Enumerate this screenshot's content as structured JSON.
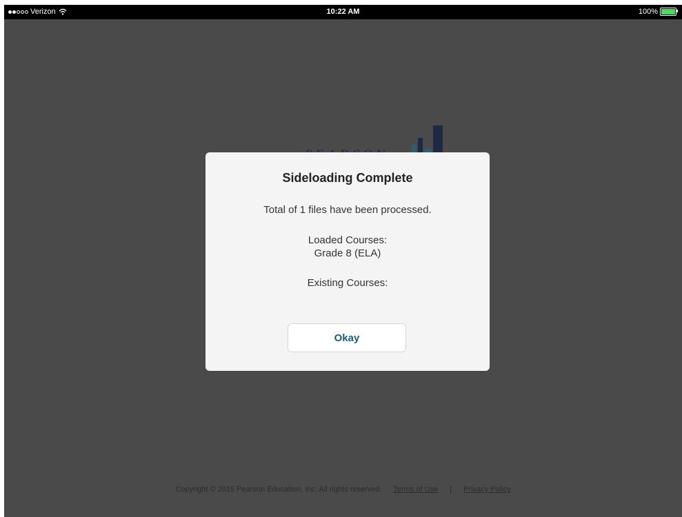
{
  "status_bar": {
    "carrier": "Verizon",
    "time": "10:22 AM",
    "battery": "100%",
    "signal_bars_filled": 2,
    "signal_bars_total": 5,
    "battery_level": 1.0,
    "battery_color": "#4cd964"
  },
  "background": {
    "logo_text": "PEARSON",
    "logo_color": "#1e2a44",
    "overlay_color": "#4a4a4a"
  },
  "modal": {
    "title": "Sideloading Complete",
    "message": "Total of 1 files have been processed.",
    "loaded_label": "Loaded Courses:",
    "loaded_course": "Grade 8 (ELA)",
    "existing_label": "Existing Courses:",
    "okay_label": "Okay",
    "button_text_color": "#1a5e73"
  },
  "footer": {
    "copyright": "Copyright © 2015 Pearson Education, Inc. All rights reserved.",
    "terms_link": "Terms of Use",
    "separator": "|",
    "privacy_link": "Privacy Policy"
  }
}
